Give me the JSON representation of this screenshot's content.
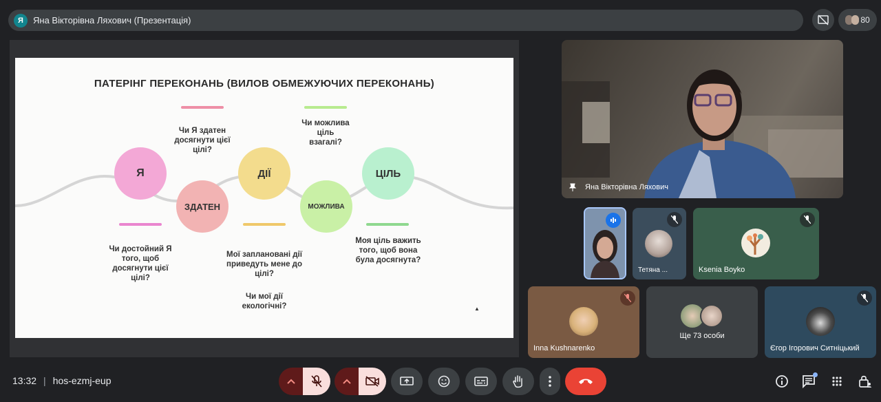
{
  "meeting": {
    "presenter_initial": "Я",
    "presenter_title": "Яна Вікторівна Ляхович (Презентація)",
    "participant_count": "80",
    "time": "13:32",
    "code": "hos-ezmj-eup"
  },
  "slide": {
    "title": "ПАТЕРІНГ ПЕРЕКОНАНЬ (ВИЛОВ ОБМЕЖУЮЧИХ ПЕРЕКОНАНЬ)",
    "bubbles": {
      "ya": "Я",
      "zdaten": "ЗДАТЕН",
      "dii": "ДІЇ",
      "mozhlyva": "МОЖЛИВА",
      "tsil": "ЦІЛЬ"
    },
    "texts": {
      "q_dostoinyi": "Чи достойний Я того, щоб досягнути цієї цілі?",
      "q_zdaten": "Чи Я здатен досягнути цієї цілі?",
      "q_dii": "Мої заплановані дії приведуть мене до цілі?",
      "q_ekolog": "Чи мої дії екологічні?",
      "q_mozhlyva": "Чи можлива ціль взагалі?",
      "q_vazhyt": "Моя ціль важить того, щоб вона була досягнута?"
    },
    "colors": {
      "pink": "#f3a8d6",
      "salmon": "#f2b3b3",
      "yellow": "#f3dc8d",
      "green": "#c9f0a6",
      "teal": "#b9f0cf",
      "wave": "#d5d5d5"
    }
  },
  "participants": {
    "main": "Яна Вікторівна Ляхович",
    "tetiana": "Тетяна ...",
    "ksenia": "Ksenia Boyko",
    "inna": "Inna Kushnarenko",
    "more": "Ще 73 особи",
    "yehor": "Єгор Ігорович Ситніцький"
  }
}
